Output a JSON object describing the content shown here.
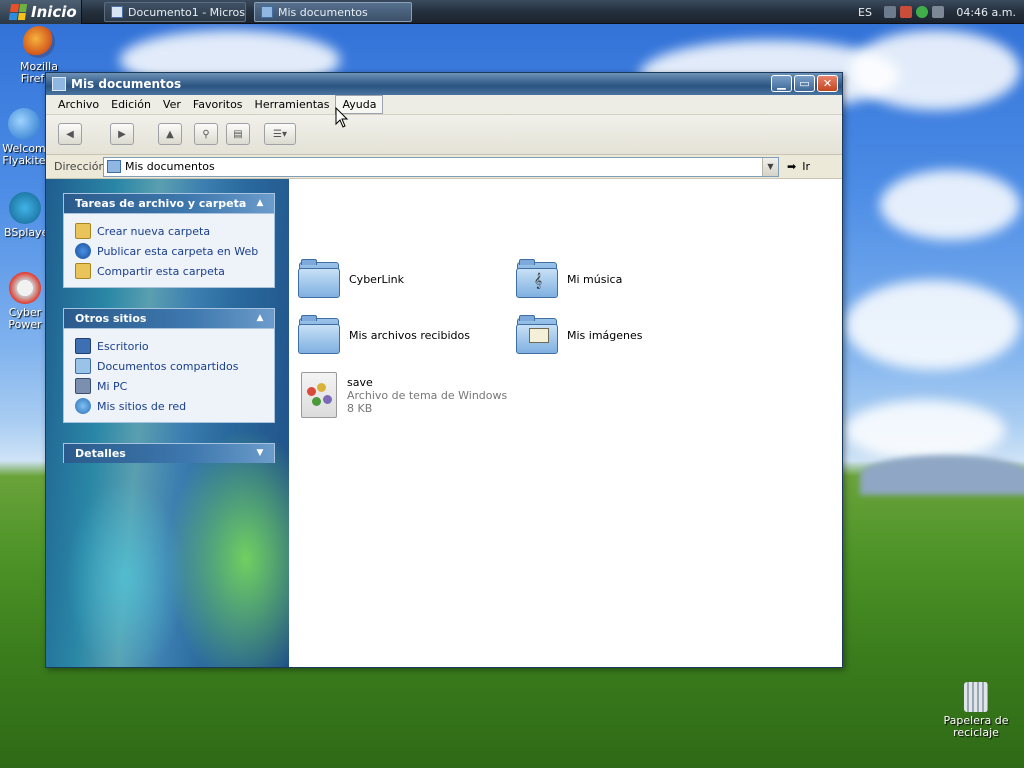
{
  "taskbar": {
    "start_label": "Inicio",
    "tasks": [
      {
        "label": "Documento1 - Micros..."
      },
      {
        "label": "Mis documentos"
      }
    ],
    "language": "ES",
    "clock": "04:46 a.m."
  },
  "desktop": {
    "icons": [
      {
        "label": "Mozilla Firefox"
      },
      {
        "label": "Welcom Flyakite"
      },
      {
        "label": "BSplayer"
      },
      {
        "label": "Cyber Power"
      },
      {
        "label": "Papelera de reciclaje"
      }
    ]
  },
  "window": {
    "title": "Mis documentos",
    "menu": [
      "Archivo",
      "Edición",
      "Ver",
      "Favoritos",
      "Herramientas",
      "Ayuda"
    ],
    "address": {
      "label": "Dirección",
      "value": "Mis documentos",
      "go_label": "Ir"
    },
    "panels": {
      "tasks": {
        "title": "Tareas de archivo y carpeta",
        "links": [
          "Crear nueva carpeta",
          "Publicar esta carpeta en Web",
          "Compartir esta carpeta"
        ]
      },
      "places": {
        "title": "Otros sitios",
        "links": [
          "Escritorio",
          "Documentos compartidos",
          "Mi PC",
          "Mis sitios de red"
        ]
      },
      "details": {
        "title": "Detalles"
      }
    },
    "items": [
      {
        "name": "CyberLink"
      },
      {
        "name": "Mi música"
      },
      {
        "name": "Mis archivos recibidos"
      },
      {
        "name": "Mis imágenes"
      },
      {
        "name": "save",
        "type": "Archivo de tema de Windows",
        "size": "8 KB"
      }
    ]
  },
  "colors": {
    "link": "#1a3f8b",
    "titlebar": "#2c5480",
    "taskbar": "#25303d"
  }
}
